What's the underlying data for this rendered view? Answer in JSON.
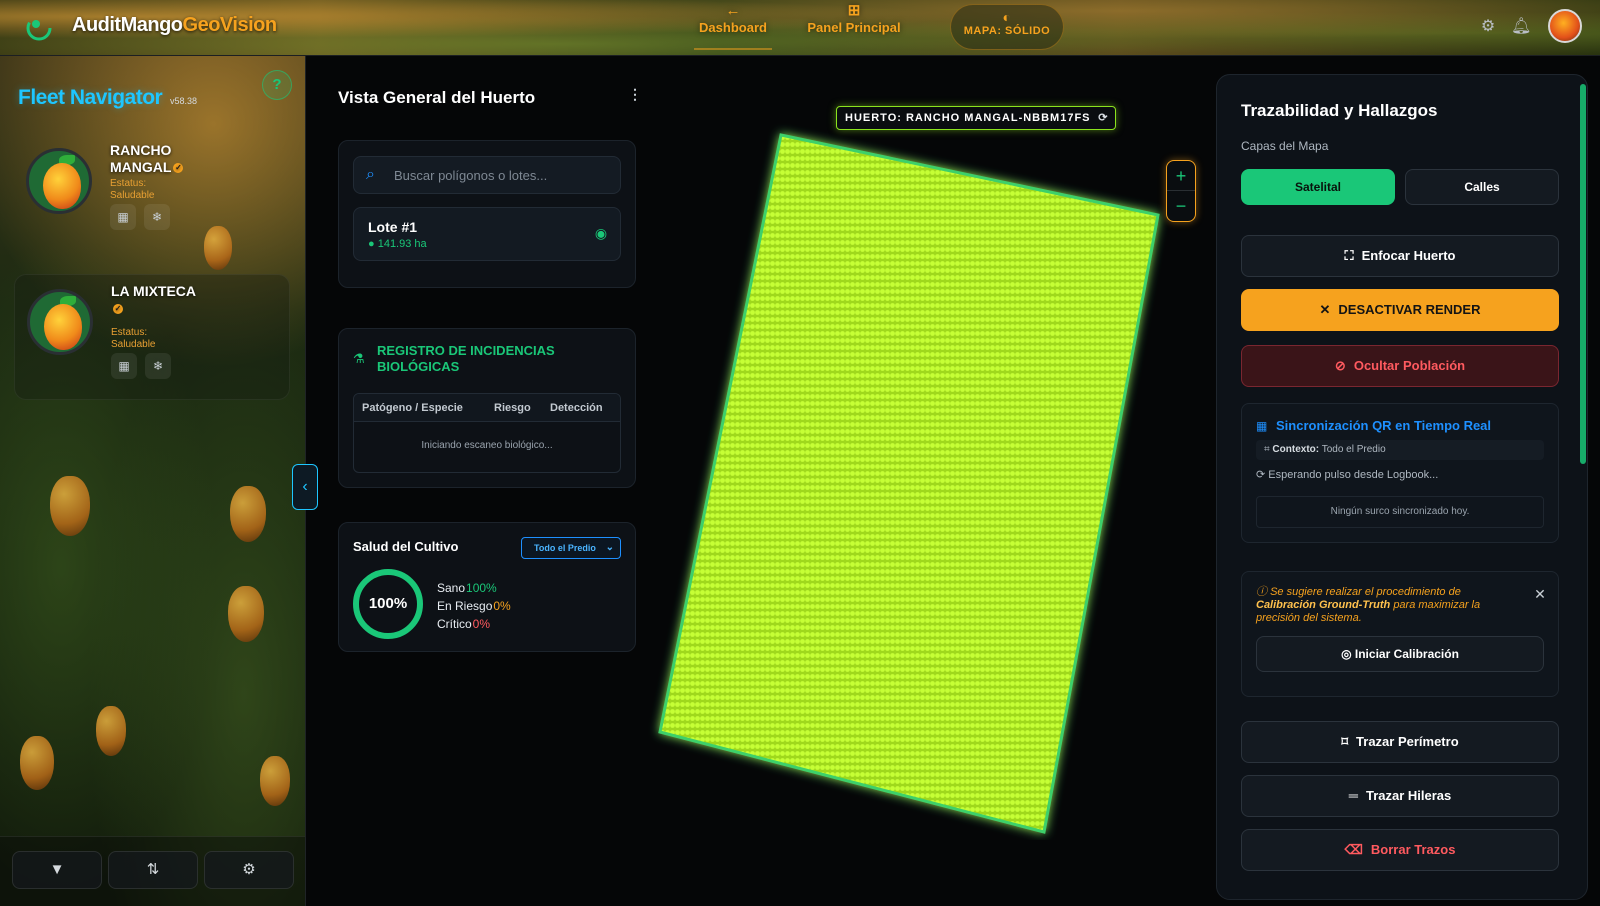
{
  "header": {
    "brand_main": "AuditMango",
    "brand_accent": "GeoVision",
    "nav": [
      {
        "label": "Dashboard",
        "icon": "arrow-left-icon"
      },
      {
        "label": "Panel Principal",
        "icon": "grid-icon"
      }
    ],
    "map_mode": "MAPA: SÓLIDO",
    "icons": [
      "gear-icon",
      "bell-icon",
      "user-avatar"
    ]
  },
  "fleet": {
    "title": "Fleet Navigator",
    "version": "v58.38",
    "help": "?",
    "farms": [
      {
        "name": "RANCHO MANGAL",
        "status": "Estatus: Saludable"
      },
      {
        "name": "LA MIXTECA",
        "status": "Estatus: Saludable"
      }
    ],
    "footer_icons": [
      "filter-icon",
      "sort-icon",
      "settings-icon"
    ]
  },
  "overview": {
    "title": "Vista General del Huerto",
    "search_placeholder": "Buscar polígonos o lotes...",
    "lote": {
      "name": "Lote #1",
      "area": "141.93 ha"
    },
    "registro": {
      "title": "REGISTRO DE INCIDENCIAS BIOLÓGICAS",
      "columns": [
        "Patógeno / Especie",
        "Riesgo",
        "Detección"
      ],
      "empty": "Iniciando escaneo biológico..."
    },
    "salud": {
      "title": "Salud del Cultivo",
      "select": "Todo el Predio",
      "ring": "100%",
      "stats": [
        {
          "label": "Sano",
          "value": "100%",
          "color": "#1ac778"
        },
        {
          "label": "En Riesgo",
          "value": "0%",
          "color": "#f6a21e"
        },
        {
          "label": "Crítico",
          "value": "0%",
          "color": "#ff5a5f"
        }
      ]
    }
  },
  "map": {
    "label": "HUERTO: RANCHO MANGAL-NBBM17FS",
    "zoom_in": "+",
    "zoom_out": "−",
    "polygon_color": "#b8f52a"
  },
  "panel": {
    "title": "Trazabilidad y Hallazgos",
    "layers_label": "Capas del Mapa",
    "layer_satelital": "Satelital",
    "layer_calles": "Calles",
    "enfocar": "Enfocar Huerto",
    "desactivar": "DESACTIVAR RENDER",
    "ocultar": "Ocultar Población",
    "qr": {
      "title": "Sincronización QR en Tiempo Real",
      "context_label": "Contexto:",
      "context_value": "Todo el Predio",
      "waiting": "Esperando pulso desde Logbook...",
      "none": "Ningún surco sincronizado hoy."
    },
    "calibracion": {
      "text_1": "Se sugiere realizar el procedimiento de",
      "text_bold": "Calibración Ground-Truth",
      "text_2": "para maximizar la precisión del sistema.",
      "button": "Iniciar Calibración"
    },
    "perimetro": "Trazar Perímetro",
    "hileras": "Trazar Hileras",
    "borrar": "Borrar Trazos"
  }
}
